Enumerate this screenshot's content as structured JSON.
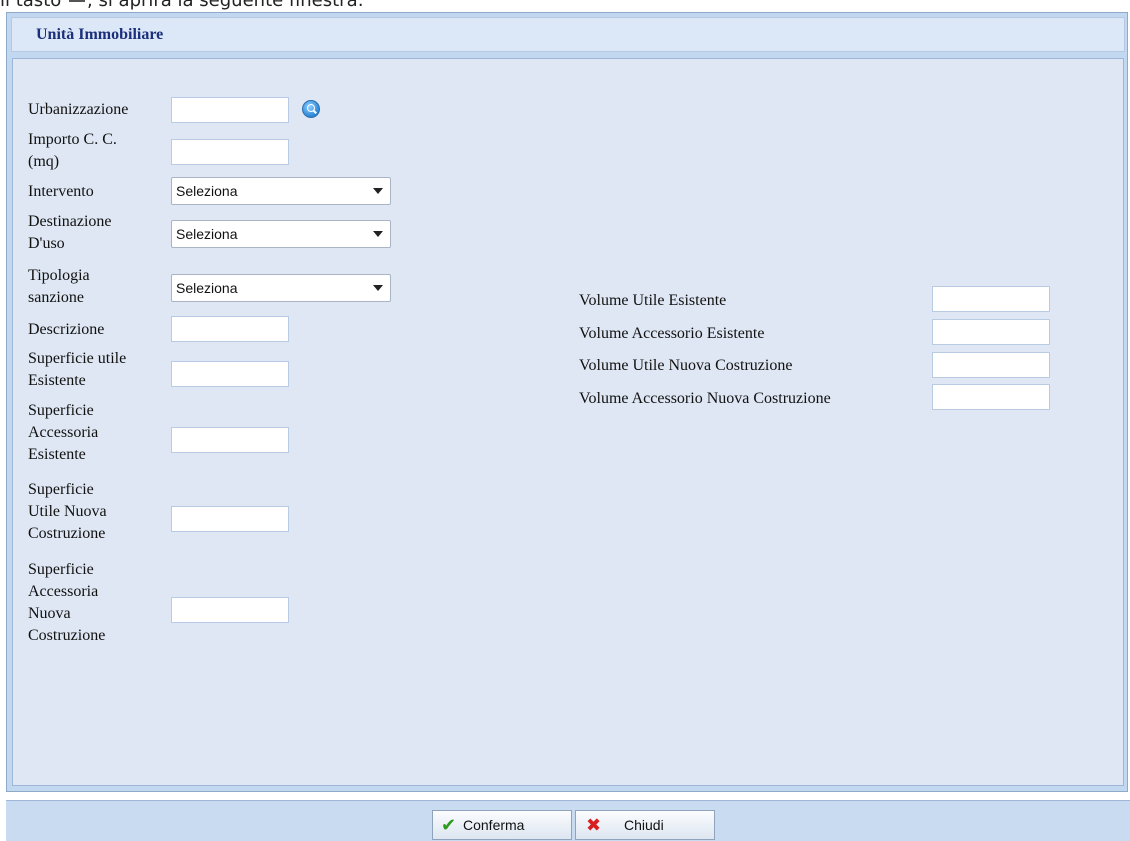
{
  "page": {
    "caption_prefix": "il tasto",
    "caption_suffix": ", si aprirà la seguente finestra:"
  },
  "window": {
    "title": "Unità Immobiliare"
  },
  "form": {
    "urbanizzazione": {
      "label": "Urbanizzazione",
      "value": ""
    },
    "importo_cc": {
      "label_line1": "Importo C. C.",
      "label_line2": "(mq)",
      "value": ""
    },
    "intervento": {
      "label": "Intervento",
      "selected": "Seleziona"
    },
    "destinazione": {
      "label_line1": "Destinazione",
      "label_line2": "D'uso",
      "selected": "Seleziona"
    },
    "tipologia": {
      "label_line1": "Tipologia",
      "label_line2": "sanzione",
      "selected": "Seleziona"
    },
    "descrizione": {
      "label": "Descrizione",
      "value": ""
    },
    "sup_utile_esistente": {
      "label_line1": "Superficie utile",
      "label_line2": "Esistente",
      "value": ""
    },
    "sup_accessoria_esistente": {
      "label_line1": "Superficie",
      "label_line2": "Accessoria",
      "label_line3": "Esistente",
      "value": ""
    },
    "sup_utile_nuova": {
      "label_line1": "Superficie",
      "label_line2": "Utile Nuova",
      "label_line3": "Costruzione",
      "value": ""
    },
    "sup_accessoria_nuova": {
      "label_line1": "Superficie",
      "label_line2": "Accessoria",
      "label_line3": "Nuova",
      "label_line4": "Costruzione",
      "value": ""
    },
    "vol_utile_esistente": {
      "label": "Volume Utile Esistente",
      "value": ""
    },
    "vol_accessorio_esistente": {
      "label": "Volume Accessorio Esistente",
      "value": ""
    },
    "vol_utile_nuova": {
      "label": "Volume Utile Nuova Costruzione",
      "value": ""
    },
    "vol_accessorio_nuova": {
      "label": "Volume Accessorio Nuova Costruzione",
      "value": ""
    }
  },
  "footer": {
    "confirm_label": "Conferma",
    "close_label": "Chiudi"
  },
  "icons": {
    "search": "search-icon",
    "confirm": "checkmark-icon",
    "close": "close-icon"
  },
  "colors": {
    "title_text": "#1b2f7a",
    "window_bg": "#c2d7f0",
    "body_bg": "#dee7f3",
    "confirm_icon": "#2e9a1f",
    "close_icon": "#d82020"
  }
}
